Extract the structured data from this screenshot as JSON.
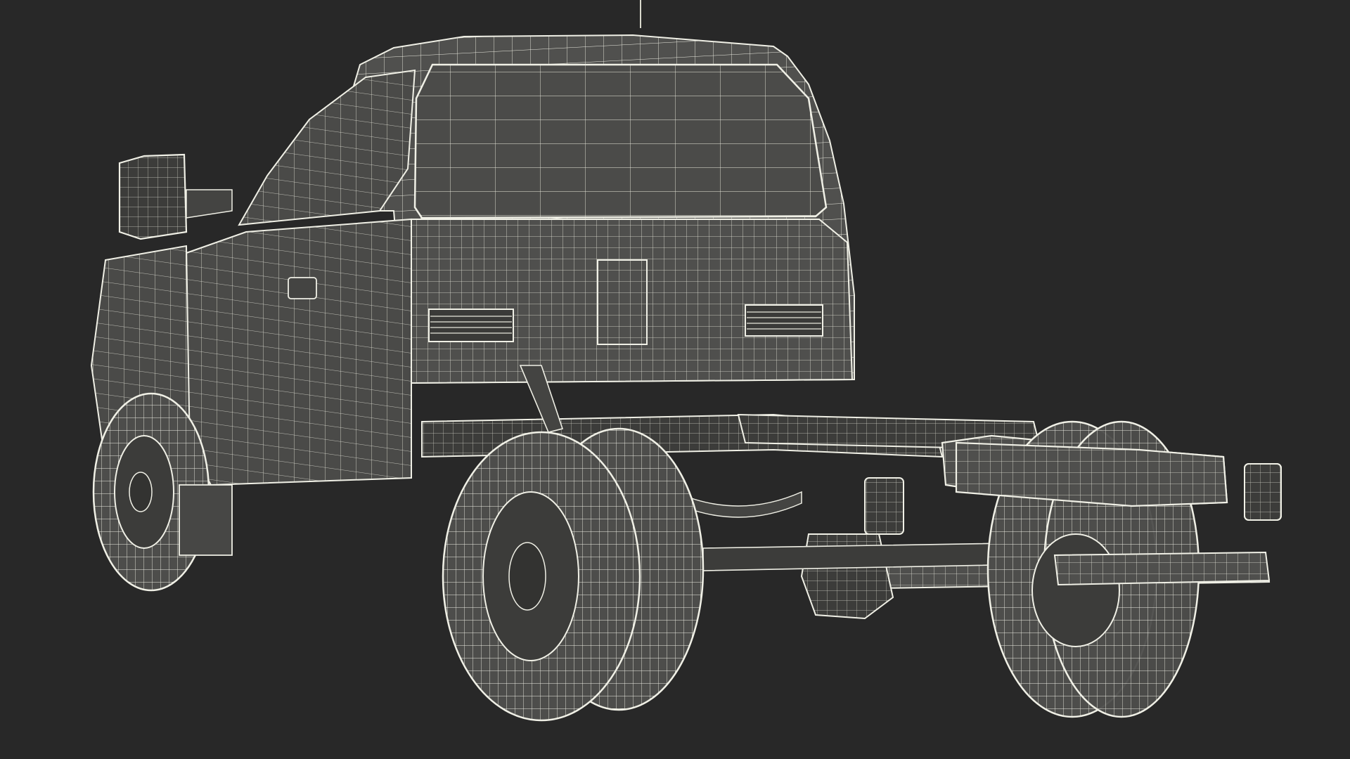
{
  "scene": {
    "subject": "truck-chassis-cab-wireframe",
    "view": "rear-three-quarter",
    "render_style": "wireframe",
    "colors": {
      "background": "#282828",
      "body_fill": "#4f4f4d",
      "body_shadow": "#454543",
      "body_dark": "#3a3a38",
      "wire": "#f0f0e6",
      "wire_dim": "#c9c9bd"
    }
  }
}
